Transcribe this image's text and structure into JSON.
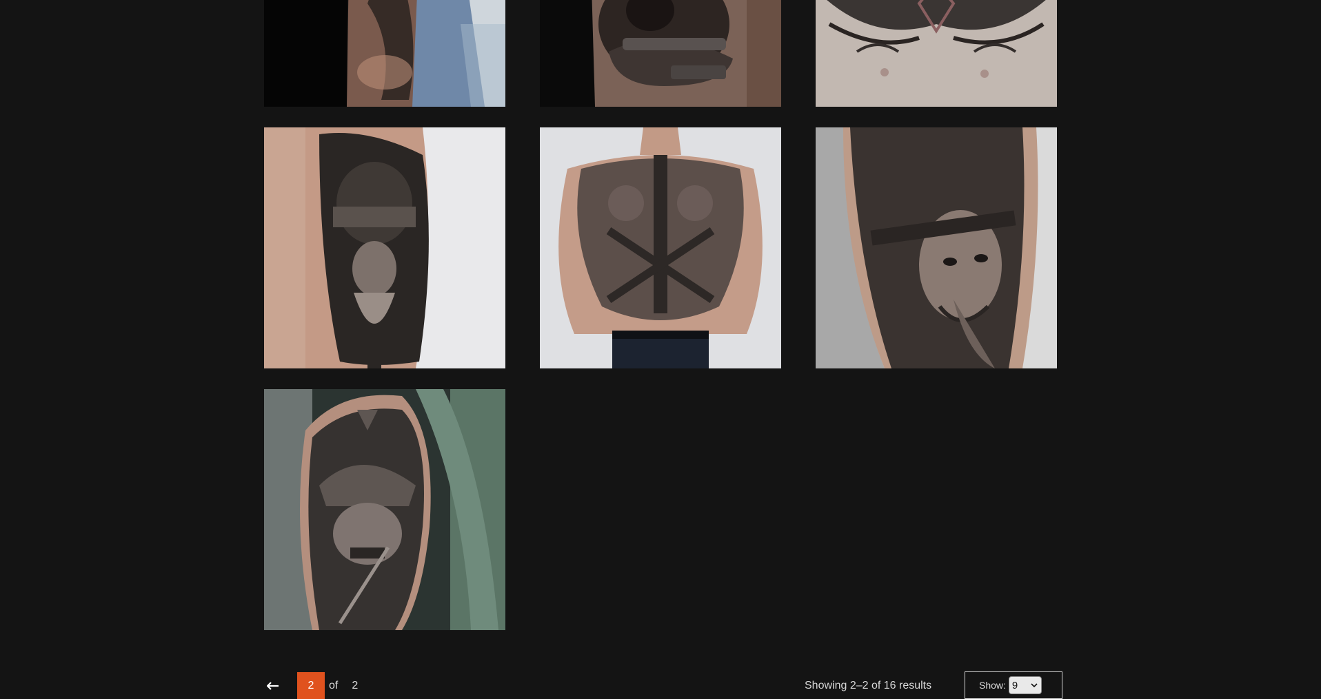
{
  "gallery": {
    "items": [
      {
        "name": "tattoo-photo-forearm-sleeve",
        "bg": "#1a1a1a"
      },
      {
        "name": "tattoo-photo-dog-thigh",
        "bg": "#0c0c0c"
      },
      {
        "name": "tattoo-photo-chest-celtic",
        "bg": "#bfb6b0"
      },
      {
        "name": "tattoo-photo-viking-arm",
        "bg": "#e8e8ea"
      },
      {
        "name": "tattoo-photo-back-axes",
        "bg": "#dcdde0"
      },
      {
        "name": "tattoo-photo-woman-portrait-arm",
        "bg": "#d9d9d9"
      },
      {
        "name": "tattoo-photo-samurai-shoulder",
        "bg": "#2a3330"
      }
    ]
  },
  "pagination": {
    "prev_icon": "arrow-left-icon",
    "current_page": "2",
    "of_label": "of",
    "total_pages": "2",
    "accent": "#e0521e"
  },
  "results": {
    "summary": "Showing 2–2 of 16 results"
  },
  "per_page": {
    "label": "Show:",
    "selected": "9",
    "dropdown_icon": "chevron-down-icon"
  }
}
